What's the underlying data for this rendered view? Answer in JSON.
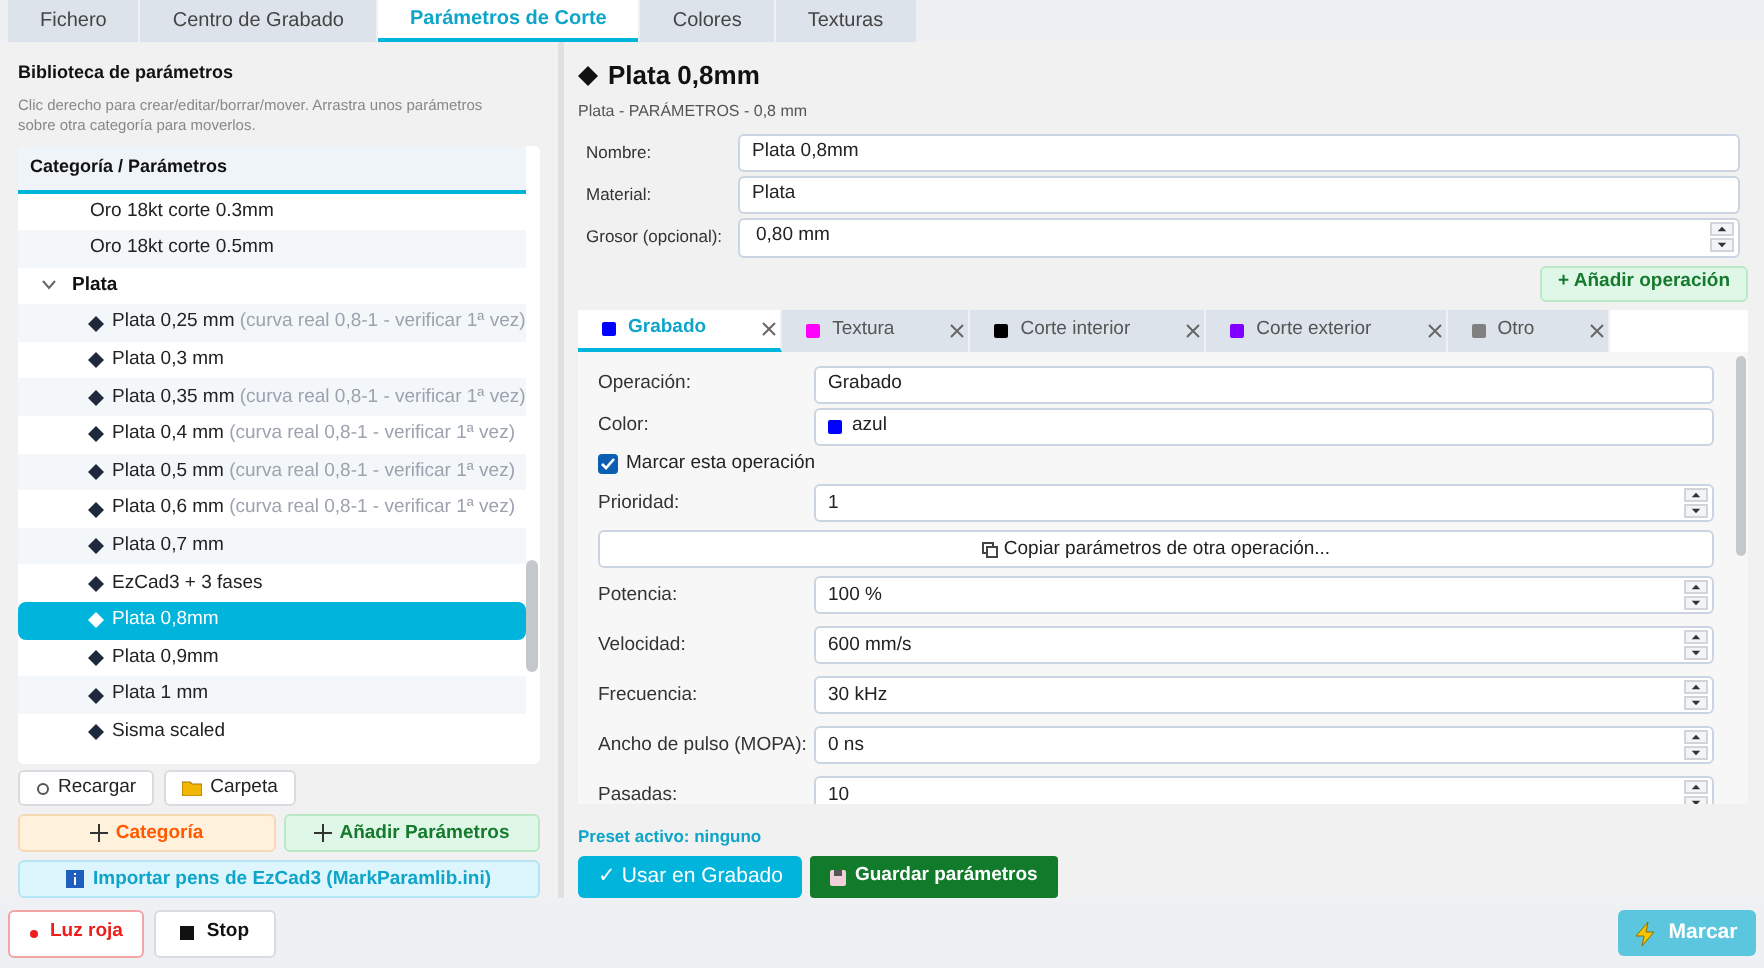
{
  "main_tabs": [
    {
      "label": "Fichero",
      "selected": false
    },
    {
      "label": "Centro de Grabado",
      "selected": false
    },
    {
      "label": "Parámetros de Corte",
      "selected": true
    },
    {
      "label": "Colores",
      "selected": false
    },
    {
      "label": "Texturas",
      "selected": false
    }
  ],
  "library": {
    "title": "Biblioteca de parámetros",
    "hint": "Clic derecho para crear/editar/borrar/mover. Arrastra unos parámetros sobre otra categoría para moverlos.",
    "header": "Categoría / Parámetros",
    "items": [
      {
        "kind": "entry",
        "label": "Oro 18kt corte 0.3mm",
        "selected": false
      },
      {
        "kind": "entry",
        "label": "Oro 18kt corte 0.5mm",
        "selected": false
      },
      {
        "kind": "category",
        "label": "Plata",
        "expanded": true,
        "children": [
          {
            "kind": "preset",
            "label": "Plata 0,25 mm",
            "note": "(curva real 0,8-1 - verificar 1ª vez)",
            "selected": false
          },
          {
            "kind": "preset",
            "label": "Plata 0,3 mm",
            "selected": false
          },
          {
            "kind": "preset",
            "label": "Plata 0,35 mm",
            "note": "(curva real 0,8-1 - verificar 1ª vez)",
            "selected": false
          },
          {
            "kind": "preset",
            "label": "Plata 0,4 mm",
            "note": "(curva real 0,8-1 - verificar 1ª vez)",
            "selected": false
          },
          {
            "kind": "preset",
            "label": "Plata 0,5 mm",
            "note": "(curva real 0,8-1 - verificar 1ª vez)",
            "selected": false
          },
          {
            "kind": "preset",
            "label": "Plata 0,6 mm",
            "note": "(curva real 0,8-1 - verificar 1ª vez)",
            "selected": false
          },
          {
            "kind": "preset",
            "label": "Plata 0,7 mm",
            "selected": false
          },
          {
            "kind": "preset",
            "label": "EzCad3 + 3 fases",
            "selected": false
          },
          {
            "kind": "preset",
            "label": "Plata 0,8mm",
            "selected": true
          },
          {
            "kind": "preset",
            "label": "Plata 0,9mm",
            "selected": false
          },
          {
            "kind": "preset",
            "label": "Plata 1 mm",
            "selected": false
          },
          {
            "kind": "preset",
            "label": "Sisma scaled",
            "selected": false
          }
        ]
      }
    ],
    "buttons": [
      {
        "kind": "reload",
        "label": "Recargar"
      },
      {
        "kind": "folder",
        "label": "Carpeta"
      }
    ],
    "category_button": "Categoría",
    "add_params_button": "Añadir Parámetros",
    "import_button": "Importar pens de EzCad3 (MarkParamlib.ini)"
  },
  "detail": {
    "title": "Plata 0,8mm",
    "subtitle": "Plata - PARÁMETROS - 0,8 mm",
    "fields": [
      {
        "kind": "text",
        "label": "Nombre:",
        "value": "Plata 0,8mm"
      },
      {
        "kind": "text",
        "label": "Material:",
        "value": "Plata"
      },
      {
        "kind": "spin",
        "label": "Grosor (opcional):",
        "value": "0,80 mm"
      }
    ],
    "add_operation": "+ Añadir operación",
    "operation_tabs": [
      {
        "label": "Grabado",
        "color": "#0000ff",
        "selected": true
      },
      {
        "label": "Textura",
        "color": "#ff00ff",
        "selected": false
      },
      {
        "label": "Corte interior",
        "color": "#000000",
        "selected": false
      },
      {
        "label": "Corte exterior",
        "color": "#8000ff",
        "selected": false
      },
      {
        "label": "Otro",
        "color": "#808080",
        "selected": false
      }
    ],
    "operation": {
      "top_fields": [
        {
          "kind": "text",
          "label": "Operación:",
          "value": "Grabado"
        },
        {
          "kind": "color",
          "label": "Color:",
          "value": "azul",
          "color": "#0000ff"
        }
      ],
      "mark": {
        "label": "Marcar esta operación",
        "checked": true
      },
      "priority": {
        "label": "Prioridad:",
        "value": "1"
      },
      "copy_button": "Copiar parámetros de otra operación...",
      "params": [
        {
          "label": "Potencia:",
          "value": "100 %"
        },
        {
          "label": "Velocidad:",
          "value": "600 mm/s"
        },
        {
          "label": "Frecuencia:",
          "value": "30 kHz"
        },
        {
          "label": "Ancho de pulso (MOPA):",
          "value": "0 ns"
        },
        {
          "label": "Pasadas:",
          "value": "10"
        }
      ]
    },
    "preset_status": "Preset activo: ninguno",
    "use_button": "✓ Usar en Grabado",
    "save_button": "Guardar parámetros"
  },
  "bottom": {
    "red_light": "Luz roja",
    "stop": "Stop",
    "mark_button": {
      "label": "Marcar",
      "disabled": true
    }
  }
}
